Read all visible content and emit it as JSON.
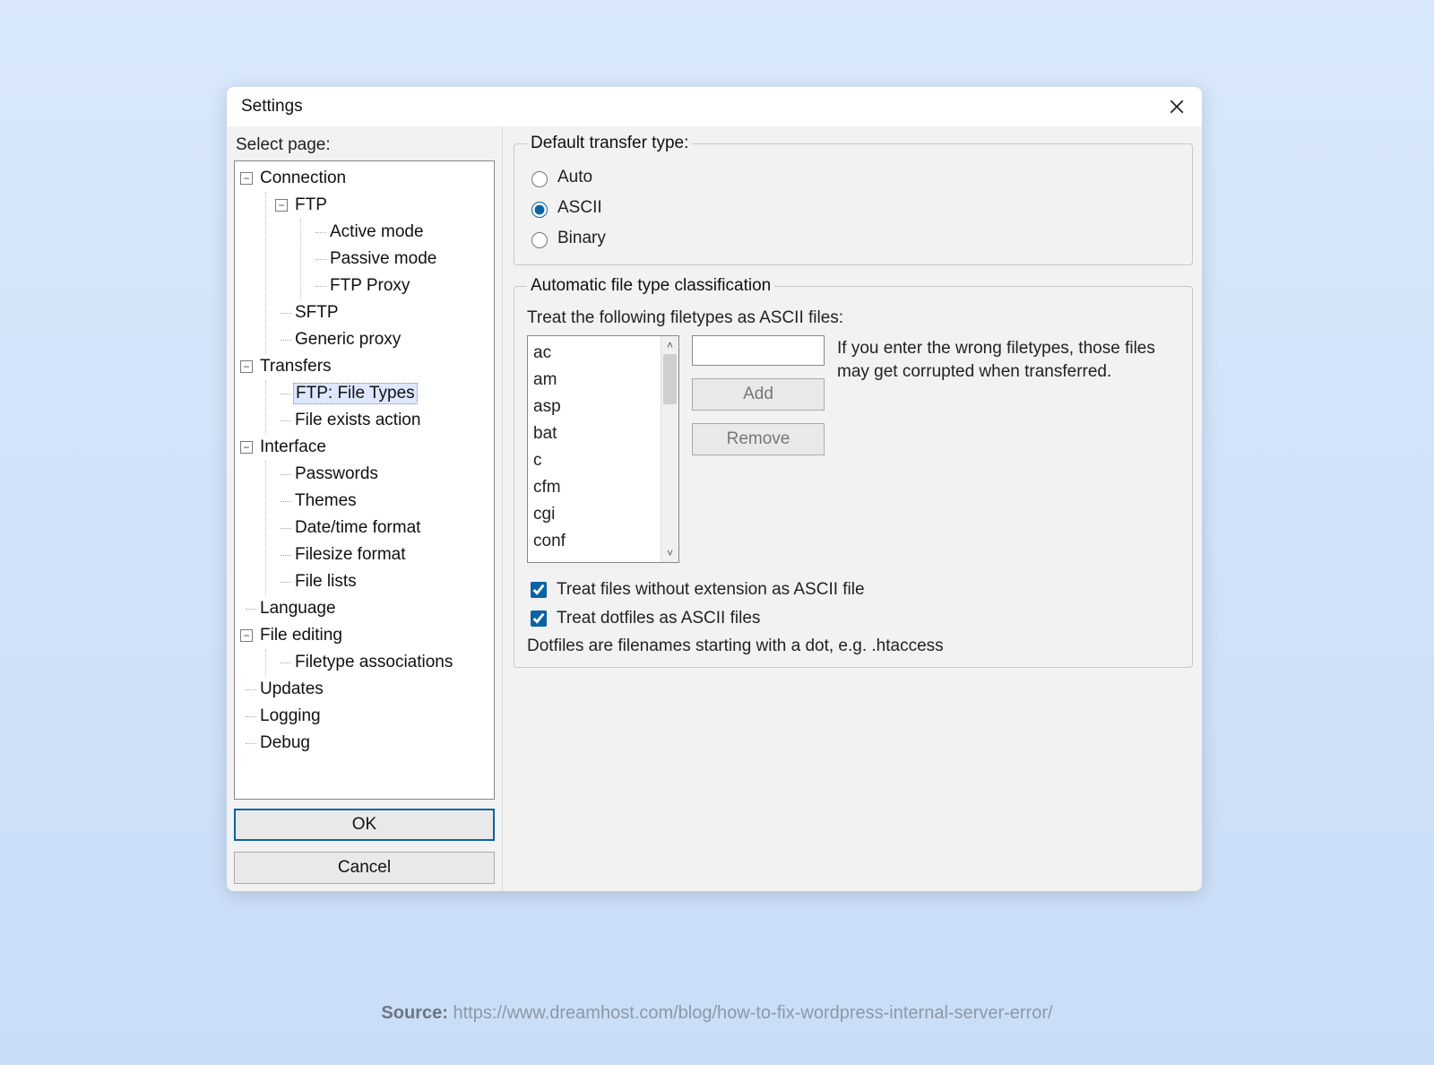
{
  "window": {
    "title": "Settings"
  },
  "left": {
    "heading": "Select page:",
    "tree": {
      "connection": "Connection",
      "ftp": "FTP",
      "ftp_active": "Active mode",
      "ftp_passive": "Passive mode",
      "ftp_proxy": "FTP Proxy",
      "sftp": "SFTP",
      "generic_proxy": "Generic proxy",
      "transfers": "Transfers",
      "ftp_file_types": "FTP: File Types",
      "file_exists": "File exists action",
      "interface": "Interface",
      "passwords": "Passwords",
      "themes": "Themes",
      "datetime": "Date/time format",
      "filesize": "Filesize format",
      "file_lists": "File lists",
      "language": "Language",
      "file_editing": "File editing",
      "filetype_assoc": "Filetype associations",
      "updates": "Updates",
      "logging": "Logging",
      "debug": "Debug"
    },
    "ok": "OK",
    "cancel": "Cancel"
  },
  "right": {
    "group1_title": "Default transfer type:",
    "radio_auto": "Auto",
    "radio_ascii": "ASCII",
    "radio_binary": "Binary",
    "group2_title": "Automatic file type classification",
    "treat_heading": "Treat the following filetypes as ASCII files:",
    "filetypes": [
      "ac",
      "am",
      "asp",
      "bat",
      "c",
      "cfm",
      "cgi",
      "conf"
    ],
    "ext_input": "",
    "add": "Add",
    "remove": "Remove",
    "hint": "If you enter the wrong filetypes, those files may get corrupted when transferred.",
    "check_noext": "Treat files without extension as ASCII file",
    "check_dot": "Treat dotfiles as ASCII files",
    "note": "Dotfiles are filenames starting with a dot, e.g. .htaccess"
  },
  "source": {
    "label": "Source:",
    "url": "https://www.dreamhost.com/blog/how-to-fix-wordpress-internal-server-error/"
  }
}
